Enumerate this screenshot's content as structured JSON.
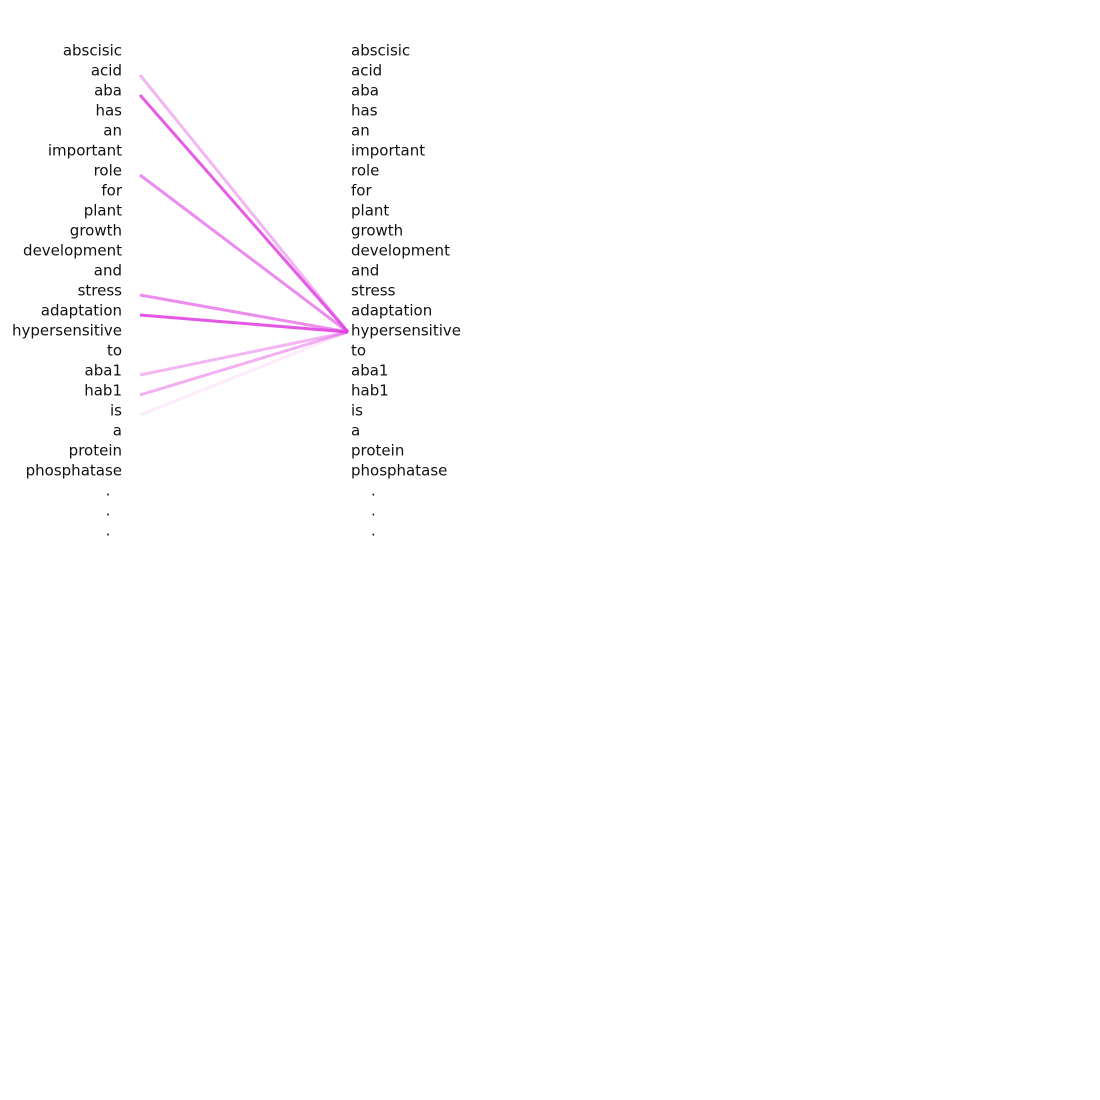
{
  "attention": {
    "tokens_left": [
      "abscisic",
      "acid",
      "aba",
      "has",
      "an",
      "important",
      "role",
      "for",
      "plant",
      "growth",
      "development",
      "and",
      "stress",
      "adaptation",
      "hypersensitive",
      "to",
      "aba1",
      "hab1",
      "is",
      "a",
      "protein",
      "phosphatase",
      ".",
      ".",
      "."
    ],
    "tokens_right": [
      "abscisic",
      "acid",
      "aba",
      "has",
      "an",
      "important",
      "role",
      "for",
      "plant",
      "growth",
      "development",
      "and",
      "stress",
      "adaptation",
      "hypersensitive",
      "to",
      "aba1",
      "hab1",
      "is",
      "a",
      "protein",
      "phosphatase",
      ".",
      ".",
      "."
    ],
    "focus_token_index": 14,
    "line_color": "#e040e0",
    "links": [
      {
        "source": 1,
        "weight": 0.38
      },
      {
        "source": 2,
        "weight": 0.85
      },
      {
        "source": 6,
        "weight": 0.6
      },
      {
        "source": 12,
        "weight": 0.6
      },
      {
        "source": 13,
        "weight": 0.88
      },
      {
        "source": 16,
        "weight": 0.38
      },
      {
        "source": 17,
        "weight": 0.42
      },
      {
        "source": 18,
        "weight": 0.1
      }
    ]
  }
}
